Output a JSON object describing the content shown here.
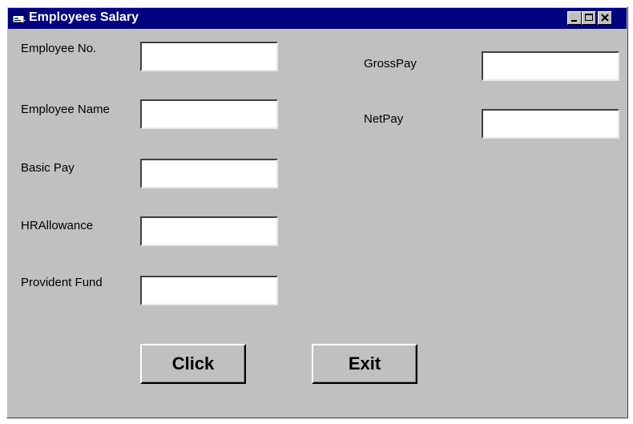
{
  "window": {
    "title": "Employees Salary",
    "icons": {
      "app": "form-icon",
      "minimize": "minimize-icon",
      "maximize": "maximize-icon",
      "close": "close-icon"
    }
  },
  "form": {
    "employee_no": {
      "label": "Employee No.",
      "value": ""
    },
    "employee_name": {
      "label": "Employee Name",
      "value": ""
    },
    "basic_pay": {
      "label": "Basic Pay",
      "value": ""
    },
    "hr_allowance": {
      "label": "HRAllowance",
      "value": ""
    },
    "provident_fund": {
      "label": "Provident Fund",
      "value": ""
    },
    "gross_pay": {
      "label": "GrossPay",
      "value": ""
    },
    "net_pay": {
      "label": "NetPay",
      "value": ""
    }
  },
  "buttons": {
    "click_label": "Click",
    "exit_label": "Exit"
  },
  "colors": {
    "titlebar": "#000080",
    "window_face": "#c0c0c0"
  }
}
